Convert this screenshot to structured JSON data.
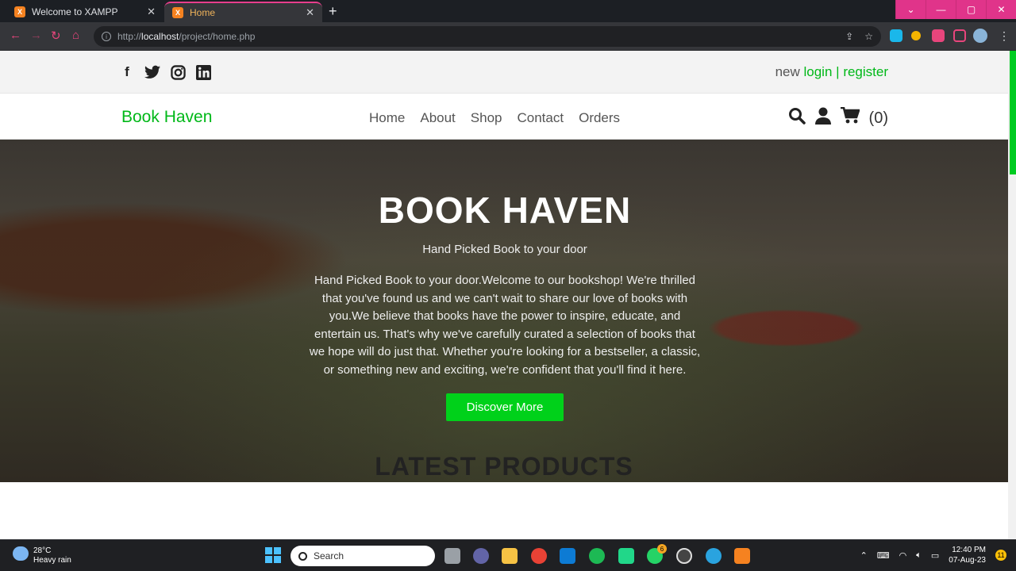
{
  "browser": {
    "tabs": [
      {
        "title": "Welcome to XAMPP",
        "active": false
      },
      {
        "title": "Home",
        "active": true
      }
    ],
    "url_prefix": "http://",
    "url_host": "localhost",
    "url_path": "/project/home.php"
  },
  "site": {
    "topbar": {
      "auth_new": "new",
      "login": "login",
      "separator": "|",
      "register": "register"
    },
    "brand": "Book Haven",
    "menu": [
      "Home",
      "About",
      "Shop",
      "Contact",
      "Orders"
    ],
    "cart_count": "(0)",
    "hero": {
      "title": "BOOK HAVEN",
      "subtitle": "Hand Picked Book to your door",
      "text": "Hand Picked Book to your door.Welcome to our bookshop! We're thrilled that you've found us and we can't wait to share our love of books with you.We believe that books have the power to inspire, educate, and entertain us. That's why we've carefully curated a selection of books that we hope will do just that. Whether you're looking for a bestseller, a classic, or something new and exciting, we're confident that you'll find it here.",
      "cta": "Discover More"
    },
    "section_title": "LATEST PRODUCTS"
  },
  "taskbar": {
    "temp": "28°C",
    "weather": "Heavy rain",
    "search": "Search",
    "time": "12:40 PM",
    "date": "07-Aug-23",
    "notifications": "11",
    "whatsapp_badge": "6"
  },
  "colors": {
    "accent": "#00b818",
    "button": "#00d11a",
    "tab_accent": "#e83e8c"
  }
}
